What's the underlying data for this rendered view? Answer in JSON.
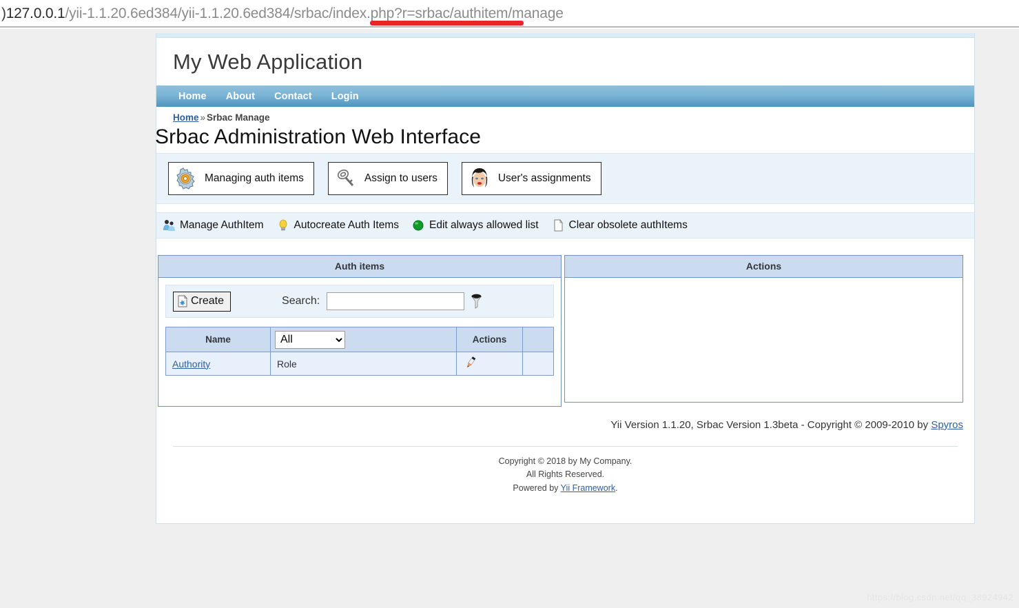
{
  "browser": {
    "url_lead": ")",
    "url_host": "127.0.0.1",
    "url_path": "/yii-1.1.20.6ed384/yii-1.1.20.6ed384/srbac/index.php?r=srbac/authitem/manage",
    "highlight_color": "#e8262a"
  },
  "site": {
    "title": "My Web Application"
  },
  "nav": {
    "items": [
      {
        "label": "Home"
      },
      {
        "label": "About"
      },
      {
        "label": "Contact"
      },
      {
        "label": "Login"
      }
    ]
  },
  "breadcrumb": {
    "home": "Home",
    "separator": "»",
    "current": "Srbac Manage"
  },
  "page": {
    "title": "Srbac Administration Web Interface"
  },
  "operations": {
    "buttons": [
      {
        "icon": "gear-orange-icon",
        "label": "Managing auth items"
      },
      {
        "icon": "key-icon",
        "label": "Assign to users"
      },
      {
        "icon": "user-face-icon",
        "label": "User's assignments"
      }
    ]
  },
  "toolbar": {
    "links": [
      {
        "icon": "users-blue-icon",
        "label": "Manage AuthItem"
      },
      {
        "icon": "lightbulb-icon",
        "label": "Autocreate Auth Items"
      },
      {
        "icon": "green-ball-icon",
        "label": "Edit always allowed list"
      },
      {
        "icon": "page-blank-icon",
        "label": "Clear obsolete authItems"
      }
    ]
  },
  "left_panel": {
    "title": "Auth items",
    "create_label": "Create",
    "create_icon": "new-page-icon",
    "search_label": "Search:",
    "search_value": "",
    "search_placeholder": "",
    "filter_icon": "funnel-icon",
    "grid": {
      "headers": [
        "Name",
        "",
        "Actions",
        ""
      ],
      "type_filter": {
        "selected": "All",
        "options": [
          "All"
        ]
      },
      "rows": [
        {
          "name": "Authority",
          "type": "Role",
          "action_icon": "pencil-icon",
          "extra": ""
        }
      ]
    }
  },
  "right_panel": {
    "title": "Actions",
    "rows": []
  },
  "srbac_credit": {
    "text": "Yii Version 1.1.20,  Srbac Version 1.3beta - Copyright © 2009-2010 by ",
    "link": "Spyros"
  },
  "footer": {
    "line1": "Copyright © 2018 by My Company.",
    "line2": "All Rights Reserved.",
    "line3_prefix": "Powered by ",
    "line3_link": "Yii Framework",
    "line3_suffix": "."
  },
  "watermark": {
    "text": "https://blog.csdn.net/qq_38924942"
  }
}
